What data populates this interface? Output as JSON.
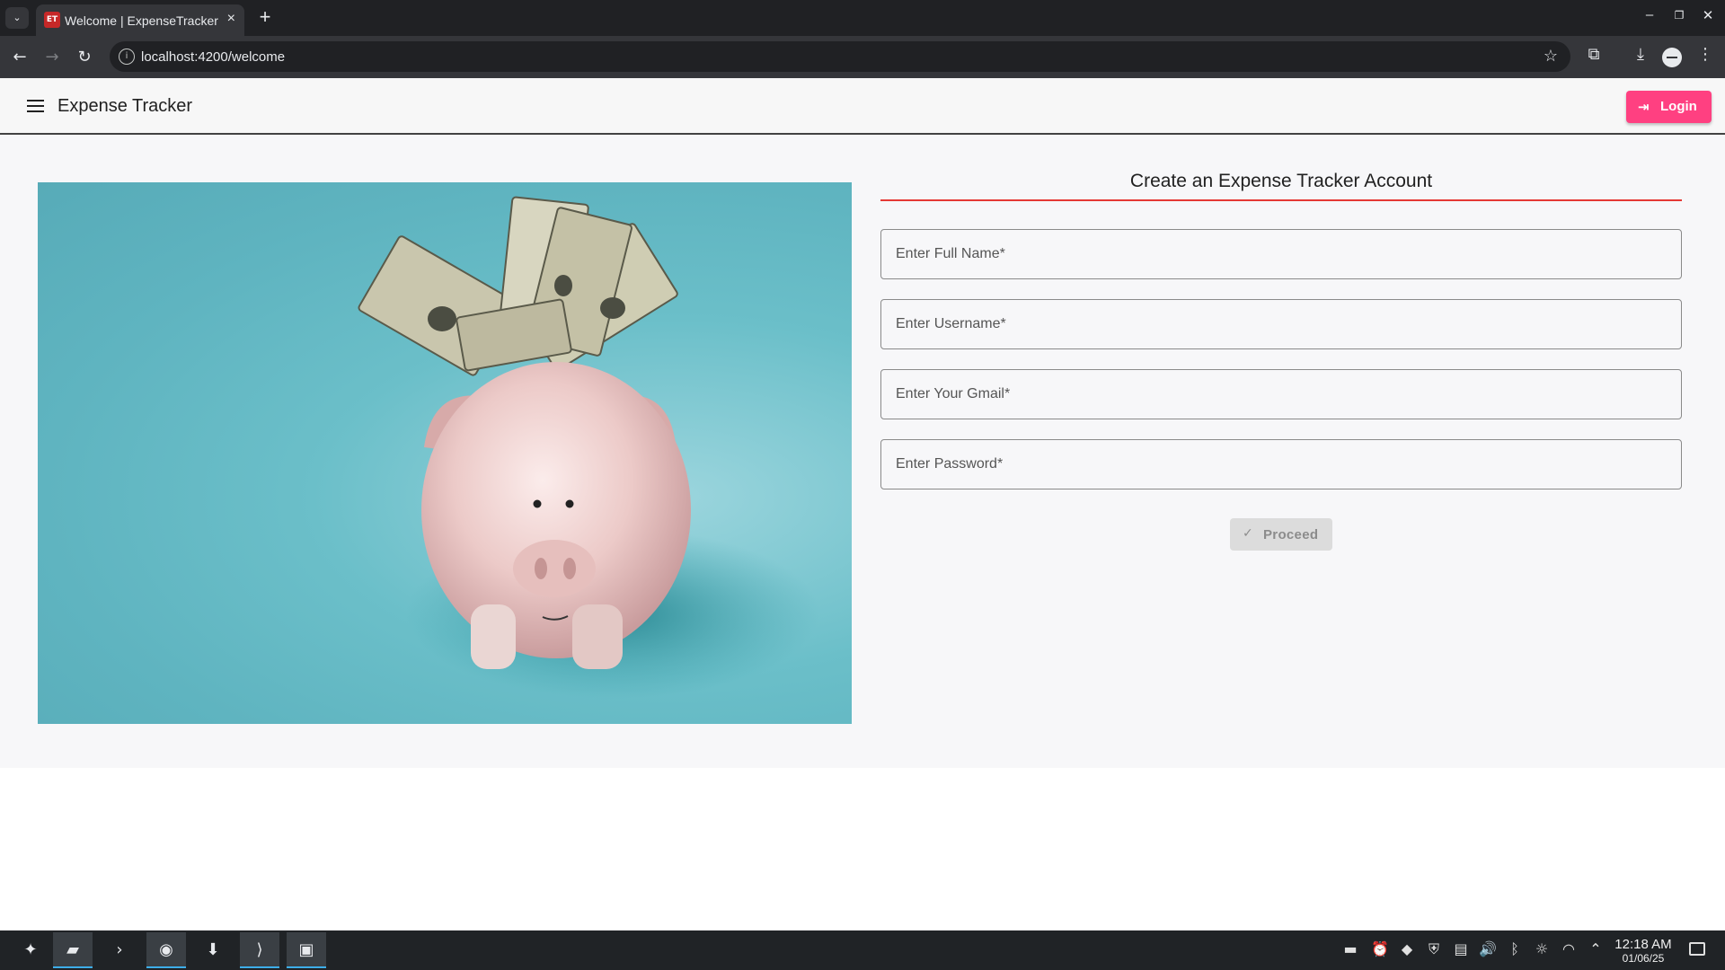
{
  "browser": {
    "tab": {
      "title": "Welcome | ExpenseTracker",
      "favicon_text": "ET"
    },
    "url": "localhost:4200/welcome"
  },
  "app": {
    "title": "Expense Tracker",
    "login_label": "Login"
  },
  "form": {
    "title": "Create an Expense Tracker Account",
    "fields": [
      {
        "placeholder": "Enter Full Name*",
        "value": ""
      },
      {
        "placeholder": "Enter Username*",
        "value": ""
      },
      {
        "placeholder": "Enter Your Gmail*",
        "value": ""
      },
      {
        "placeholder": "Enter Password*",
        "value": ""
      }
    ],
    "proceed_label": "Proceed",
    "proceed_enabled": false
  },
  "hero": {
    "subject": "piggy-bank-with-dollar-bills"
  },
  "taskbar": {
    "time": "12:18 AM",
    "date": "01/06/25"
  },
  "colors": {
    "accent": "#ff4081",
    "rule": "#e53935",
    "hero_bg": "#6bbfc9"
  }
}
